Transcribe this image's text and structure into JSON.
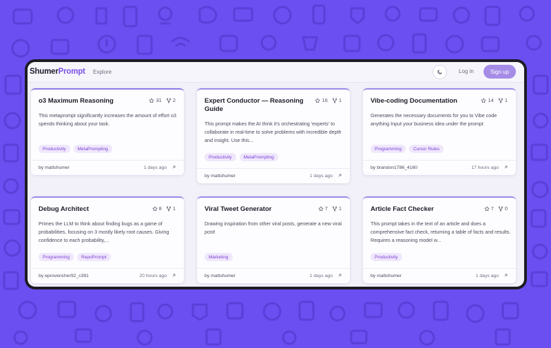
{
  "header": {
    "logo_part1": "Shumer",
    "logo_part2": "Prompt",
    "nav_explore": "Explore",
    "login_label": "Log in",
    "signup_label": "Sign up"
  },
  "colors": {
    "background": "#6b4ff0",
    "accent": "#7a52e8",
    "signup_button": "#a58ce6",
    "tag_text": "#7d3fd6",
    "tag_bg": "#efe7fb"
  },
  "icons": {
    "theme_toggle": "moon-icon",
    "stars": "star-icon",
    "forks": "fork-icon",
    "open": "arrow-up-right-icon"
  },
  "cards": [
    {
      "title": "o3 Maximum Reasoning",
      "stars": "31",
      "forks": "2",
      "description": "This metaprompt significantly increases the amount of effort o3 spends thinking about your task.",
      "tags": [
        "Productivity",
        "MetaPrompting"
      ],
      "author": "by mattshumer",
      "time": "1 days ago"
    },
    {
      "title": "Expert Conductor — Reasoning Guide",
      "stars": "16",
      "forks": "1",
      "description": "This prompt makes the AI think it's orchestrating 'experts' to collaborate in real-time to solve problems with incredible depth and insight. Use this...",
      "tags": [
        "Productivity",
        "MetaPrompting"
      ],
      "author": "by mattshumer",
      "time": "1 days ago"
    },
    {
      "title": "Vibe-coding Documentation",
      "stars": "14",
      "forks": "1",
      "description": "Generates the necessary documents for you to Vibe code anything Input your business idea under the prompt",
      "tags": [
        "Programming",
        "Cursor Rules"
      ],
      "author": "by brandon1786_4160",
      "time": "17 hours ago"
    },
    {
      "title": "Debug Architect",
      "stars": "8",
      "forks": "1",
      "description": "Primes the LLM to think about finding bugs as a game of probabilities, focusing on 3 mostly likely root causes. Giving confidence to each probability,...",
      "tags": [
        "Programming",
        "RepoPrompt"
      ],
      "author": "by eprovencher92_c391",
      "time": "20 hours ago"
    },
    {
      "title": "Viral Tweet Generator",
      "stars": "7",
      "forks": "1",
      "description": "Drawing inspiration from other viral posts, generate a new viral post!",
      "tags": [
        "Marketing"
      ],
      "author": "by mattshumer",
      "time": "1 days ago"
    },
    {
      "title": "Article Fact Checker",
      "stars": "7",
      "forks": "0",
      "description": "This prompt takes in the text of an article and does a comprehensive fact check, returning a table of facts and results. Requires a reasoning model w...",
      "tags": [
        "Productivity"
      ],
      "author": "by mattshumer",
      "time": "1 days ago"
    }
  ]
}
